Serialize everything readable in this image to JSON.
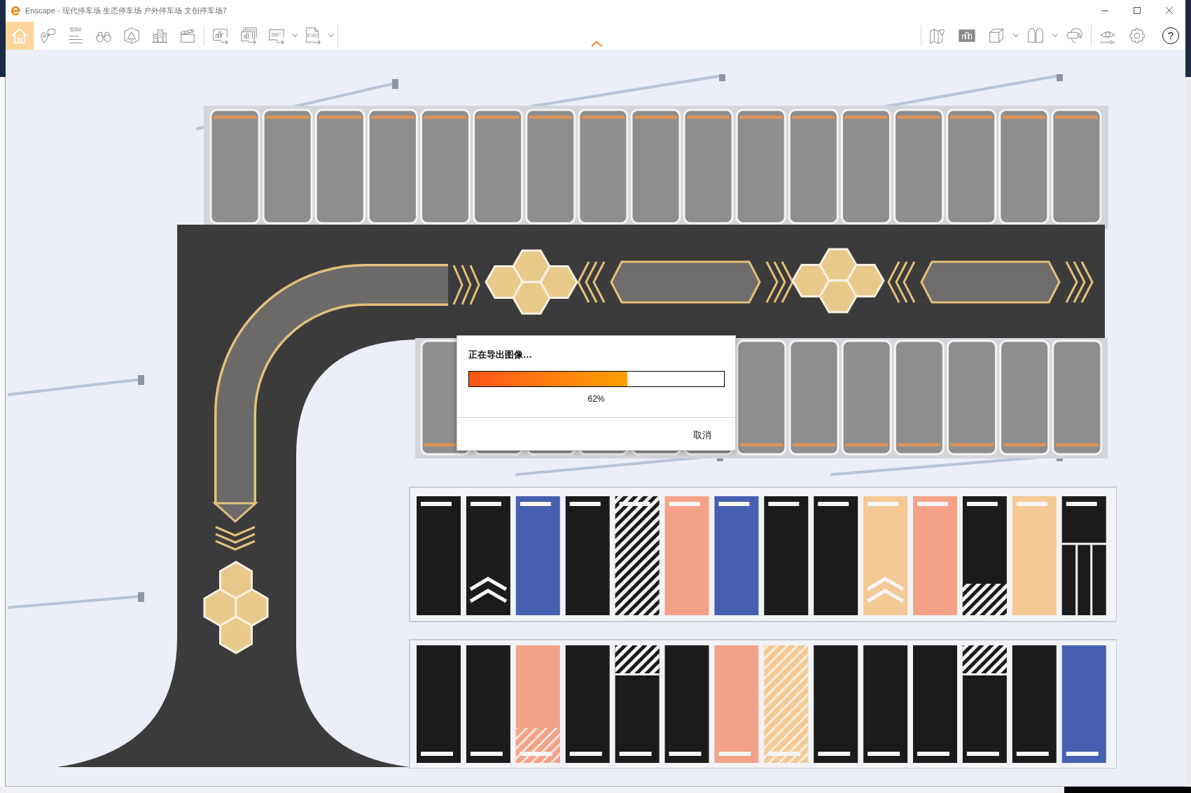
{
  "window": {
    "title": "Enscape - 现代停车场 生态停车场 户外停车场 文创停车场7",
    "controls": [
      {
        "kind": "minimize"
      },
      {
        "kind": "maximize"
      },
      {
        "kind": "close"
      }
    ]
  },
  "toolbar": {
    "left": [
      {
        "tools": [
          {
            "kind": "home",
            "selected": true,
            "dropdown": false
          },
          {
            "kind": "location",
            "selected": false,
            "dropdown": false
          },
          {
            "kind": "bim",
            "label": "BIM",
            "selected": false,
            "dropdown": false
          },
          {
            "kind": "binoculars",
            "selected": false,
            "dropdown": false
          },
          {
            "kind": "perspective",
            "selected": false,
            "dropdown": false
          },
          {
            "kind": "buildings",
            "selected": false,
            "dropdown": false
          },
          {
            "kind": "clapper",
            "selected": false,
            "dropdown": false
          }
        ]
      },
      {
        "tools": [
          {
            "kind": "render",
            "selected": false,
            "dropdown": false
          },
          {
            "kind": "batch",
            "selected": false,
            "dropdown": false
          },
          {
            "kind": "panorama",
            "label": "360°",
            "selected": false,
            "dropdown": true
          },
          {
            "kind": "exe",
            "label": "EXE",
            "selected": false,
            "dropdown": true
          }
        ]
      }
    ],
    "right": [
      {
        "tools": [
          {
            "kind": "map",
            "selected": false,
            "dropdown": false
          },
          {
            "kind": "views",
            "selected": false,
            "dropdown": false
          },
          {
            "kind": "box",
            "selected": false,
            "dropdown": true
          },
          {
            "kind": "assets",
            "selected": false,
            "dropdown": true
          },
          {
            "kind": "vr",
            "selected": false,
            "dropdown": false
          }
        ]
      },
      {
        "tools": [
          {
            "kind": "visual",
            "selected": false,
            "dropdown": false
          },
          {
            "kind": "settings",
            "selected": false,
            "dropdown": false
          },
          {
            "kind": "help",
            "label": "?",
            "selected": false,
            "dropdown": false
          }
        ]
      }
    ]
  },
  "export_dialog": {
    "title": "正在导出图像…",
    "progress": {
      "level": 0.62,
      "reading": "62%"
    },
    "cancel_button": "取消"
  }
}
